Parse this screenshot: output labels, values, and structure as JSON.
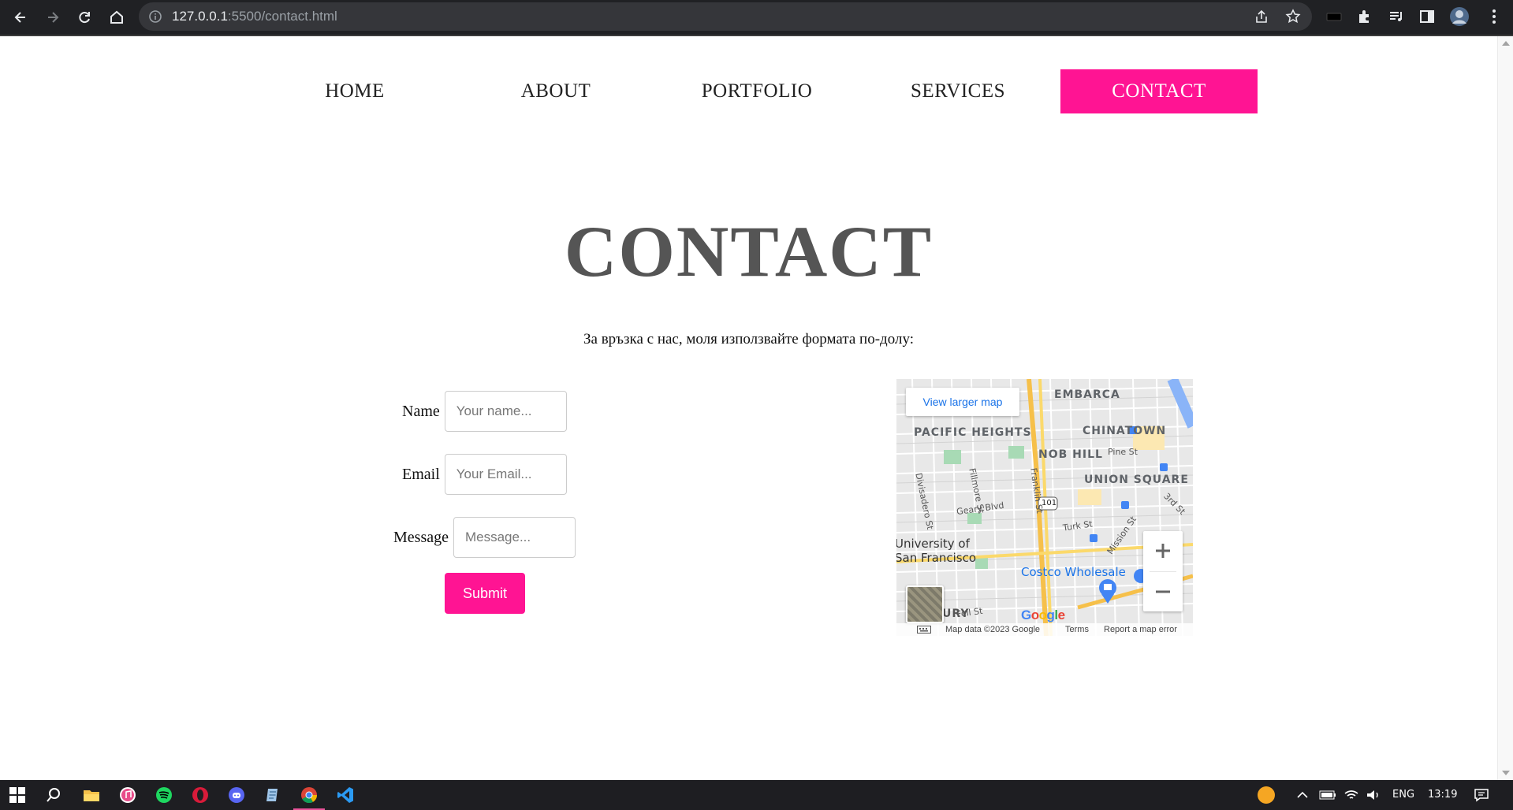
{
  "browser": {
    "url_host": "127.0.0.1",
    "url_rest": ":5500/contact.html"
  },
  "nav": {
    "items": [
      {
        "label": "HOME"
      },
      {
        "label": "ABOUT"
      },
      {
        "label": "PORTFOLIO"
      },
      {
        "label": "SERVICES"
      },
      {
        "label": "CONTACT",
        "active": true
      }
    ],
    "active_color": "#ff1493"
  },
  "page": {
    "heading": "CONTACT",
    "intro": "За връзка с нас, моля използвайте формата по-долу:"
  },
  "form": {
    "name_label": "Name",
    "name_placeholder": "Your name...",
    "email_label": "Email",
    "email_placeholder": "Your Email...",
    "message_label": "Message",
    "message_placeholder": "Message...",
    "submit_label": "Submit"
  },
  "map": {
    "view_larger": "View larger map",
    "areas": [
      "PACIFIC HEIGHTS",
      "CHINATOWN",
      "NOB HILL",
      "UNION SQUARE",
      "EMBARCA"
    ],
    "streets": [
      "Pine St",
      "Divisadero St",
      "Fillmore St",
      "Franklin St",
      "Geary Blvd",
      "Turk St",
      "Mission St",
      "3rd St",
      "Fell St"
    ],
    "places": [
      "University of",
      "San Francisco",
      "Costco Wholesale",
      "URY"
    ],
    "footer": {
      "data": "Map data ©2023 Google",
      "terms": "Terms",
      "report": "Report a map error"
    },
    "logo": "Google",
    "highway": "101"
  },
  "taskbar": {
    "lang": "ENG",
    "time": "13:19"
  }
}
